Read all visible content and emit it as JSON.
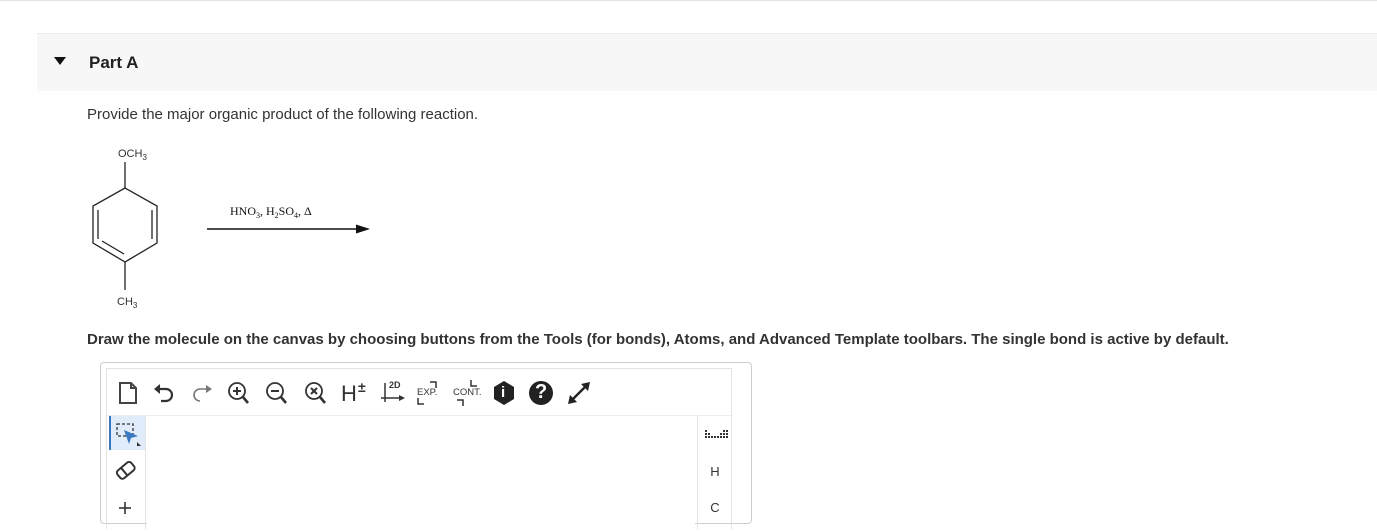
{
  "part": {
    "title": "Part A"
  },
  "question": {
    "text": "Provide the major organic product of the following reaction."
  },
  "reaction": {
    "substituent_top": "OCH3",
    "substituent_bottom": "CH3",
    "reagents": "HNO3, H2SO4, Δ"
  },
  "instruction": {
    "text": "Draw the molecule on the canvas by choosing buttons from the Tools (for bonds), Atoms, and Advanced Template toolbars. The single bond is active by default."
  },
  "editor": {
    "toolbar": {
      "h_label": "H",
      "h_sup": "±",
      "two_d_label": "2D",
      "exp_label": "EXP.",
      "cont_label": "CONT.",
      "info_label": "i",
      "help_label": "?"
    },
    "atoms": [
      "H",
      "C"
    ]
  },
  "colors": {
    "header_bg": "#f7f7f7",
    "active_tool": "#e0ecf9",
    "accent": "#3a78c2"
  },
  "icons": [
    "caret-down-icon",
    "new-document-icon",
    "undo-icon",
    "redo-icon",
    "zoom-in-icon",
    "zoom-out-icon",
    "clear-icon",
    "explicit-hydrogen-icon",
    "clean-2d-icon",
    "expand-icon",
    "contract-icon",
    "info-icon",
    "help-icon",
    "fullscreen-icon",
    "select-icon",
    "eraser-icon",
    "periodic-table-icon"
  ]
}
